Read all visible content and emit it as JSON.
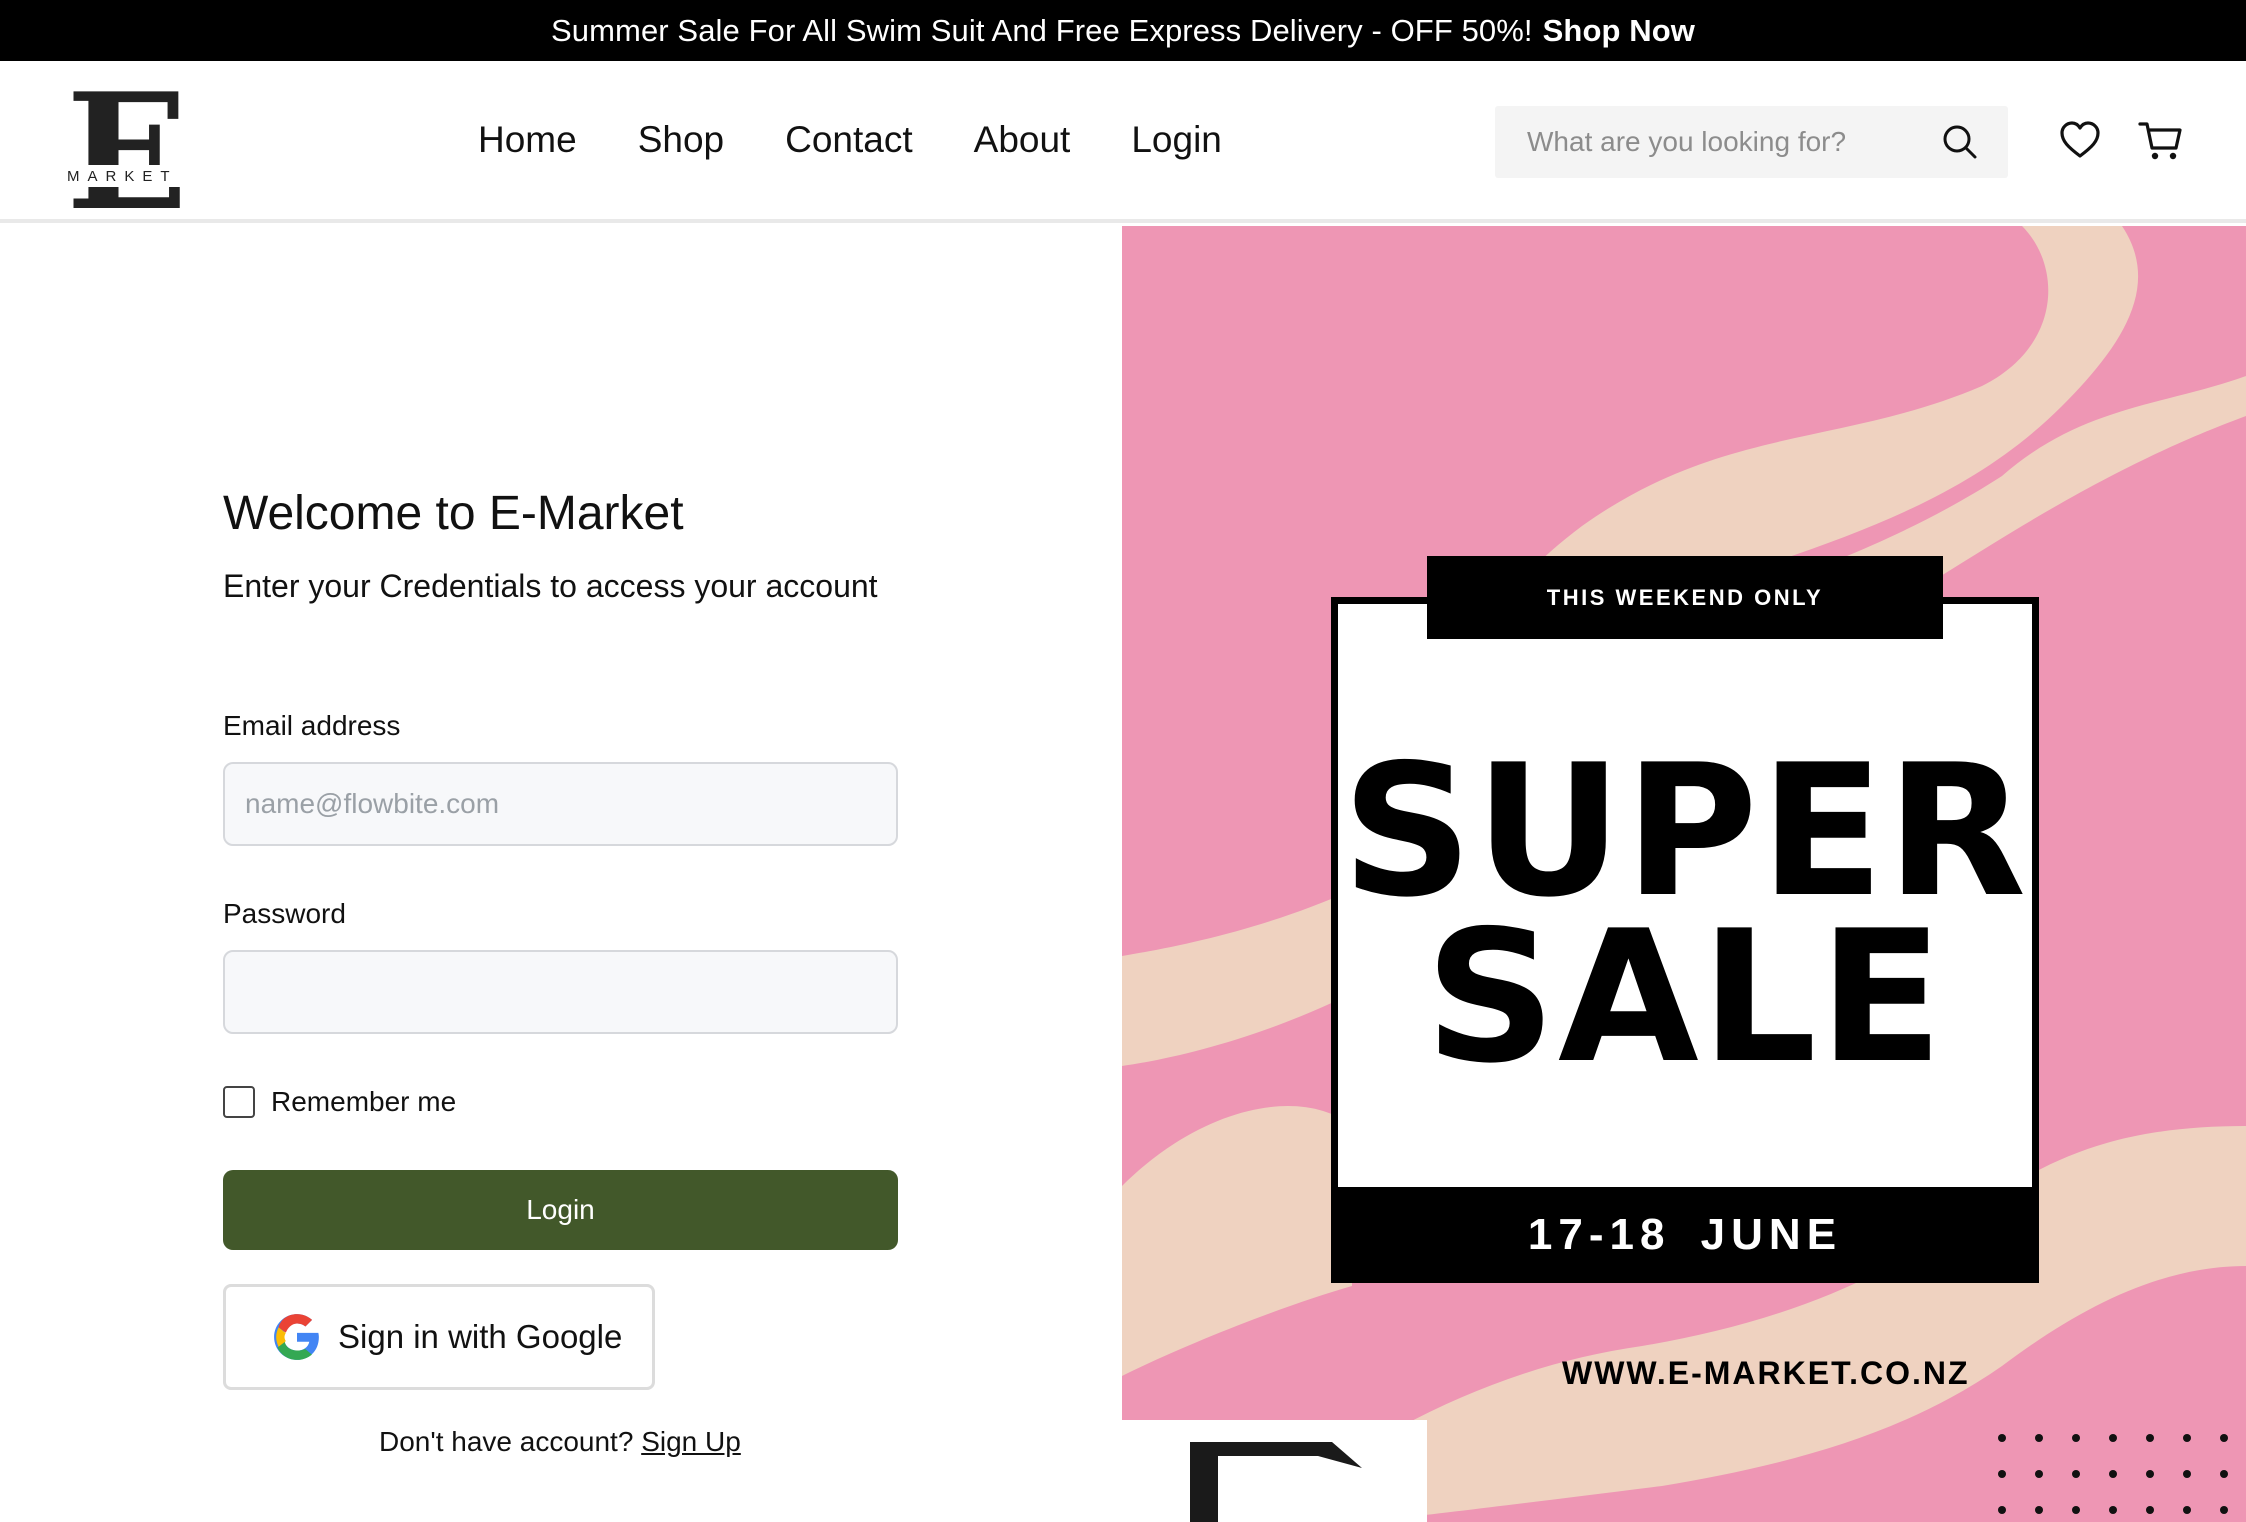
{
  "banner": {
    "text": "Summer Sale For All Swim Suit And Free Express Delivery - OFF 50%!",
    "link": "Shop Now"
  },
  "logo": {
    "letter": "E",
    "word": "MARKET"
  },
  "nav": {
    "items": [
      "Home",
      "Shop",
      "Contact",
      "About",
      "Login"
    ]
  },
  "search": {
    "placeholder": "What are you looking for?"
  },
  "form": {
    "title": "Welcome to E-Market",
    "subtitle": "Enter your Credentials to access your account",
    "email_label": "Email address",
    "email_placeholder": "name@flowbite.com",
    "password_label": "Password",
    "remember_label": "Remember me",
    "login_button": "Login",
    "google_button": "Sign in with Google",
    "signup_prompt": "Don't have account?",
    "signup_link": "Sign Up"
  },
  "promo": {
    "tag": "THIS WEEKEND ONLY",
    "headline_1": "SUPER",
    "headline_2": "SALE",
    "dates": "17-18 JUNE",
    "url": "WWW.E-MARKET.CO.NZ"
  },
  "colors": {
    "login_button": "#42582a",
    "promo_pink": "#ee96b4",
    "promo_beige": "#efd2c0"
  }
}
